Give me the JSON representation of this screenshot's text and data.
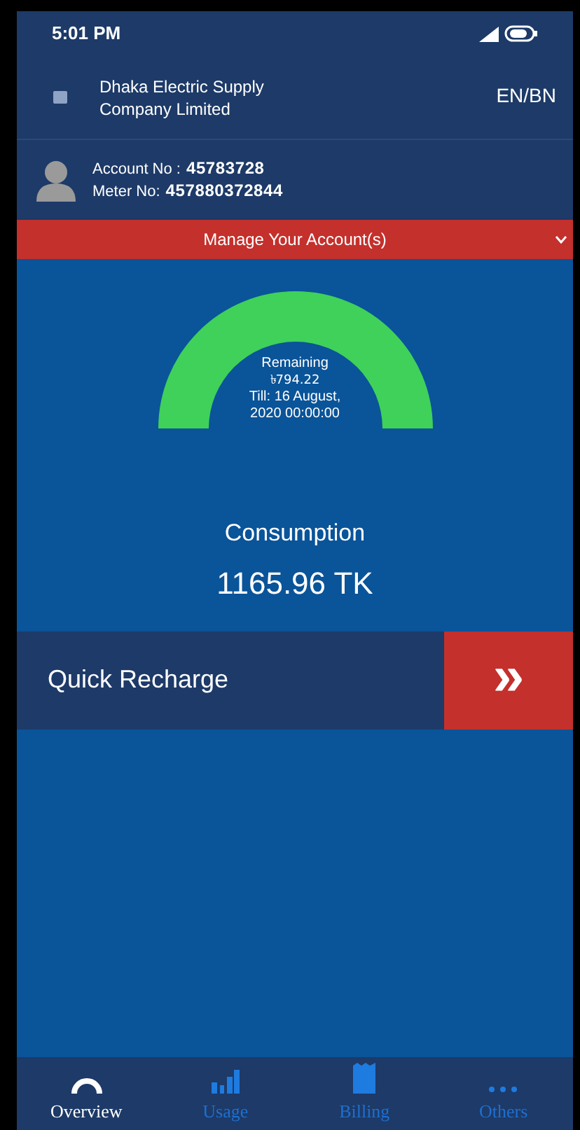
{
  "status_bar": {
    "time": "5:01 PM"
  },
  "header": {
    "title_line_1": "Dhaka Electric Supply",
    "title_line_2": "Company Limited",
    "language": "EN/BN"
  },
  "account": {
    "account_label": "Account No :",
    "account_number": "45783728",
    "meter_label": "Meter No:",
    "meter_number": "457880372844"
  },
  "manage_bar": {
    "label": "Manage Your Account(s)"
  },
  "gauge": {
    "label": "Remaining",
    "amount": "৳794.22",
    "till_line_1": "Till: 16 August,",
    "till_line_2": "2020 00:00:00"
  },
  "consumption": {
    "label": "Consumption",
    "value": "1165.96 TK"
  },
  "quick_recharge": {
    "label": "Quick Recharge",
    "button": "»"
  },
  "nav": [
    {
      "label": "Overview",
      "kind": "arc",
      "selected": true
    },
    {
      "label": "Usage",
      "kind": "bars",
      "selected": false
    },
    {
      "label": "Billing",
      "kind": "receipt",
      "selected": false
    },
    {
      "label": "Others",
      "kind": "dots",
      "selected": false
    }
  ]
}
